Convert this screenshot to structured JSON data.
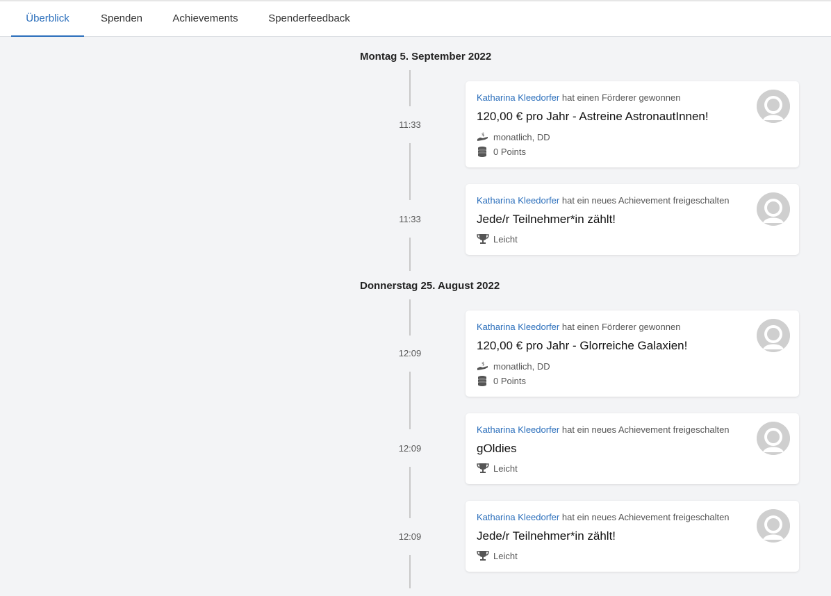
{
  "tabs": [
    {
      "label": "Überblick",
      "active": true
    },
    {
      "label": "Spenden",
      "active": false
    },
    {
      "label": "Achievements",
      "active": false
    },
    {
      "label": "Spenderfeedback",
      "active": false
    }
  ],
  "groups": [
    {
      "date": "Montag 5. September 2022",
      "entries": [
        {
          "time": "11:33",
          "user": "Katharina Kleedorfer",
          "action": "hat einen Förderer gewonnen",
          "title": "120,00 € pro Jahr - Astreine AstronautInnen!",
          "frequency": "monatlich, DD",
          "points": "0 Points"
        },
        {
          "time": "11:33",
          "user": "Katharina Kleedorfer",
          "action": "hat ein neues Achievement freigeschalten",
          "title": "Jede/r Teilnehmer*in zählt!",
          "difficulty": "Leicht"
        }
      ]
    },
    {
      "date": "Donnerstag 25. August 2022",
      "entries": [
        {
          "time": "12:09",
          "user": "Katharina Kleedorfer",
          "action": "hat einen Förderer gewonnen",
          "title": "120,00 € pro Jahr - Glorreiche Galaxien!",
          "frequency": "monatlich, DD",
          "points": "0 Points"
        },
        {
          "time": "12:09",
          "user": "Katharina Kleedorfer",
          "action": "hat ein neues Achievement freigeschalten",
          "title": "gOldies",
          "difficulty": "Leicht"
        },
        {
          "time": "12:09",
          "user": "Katharina Kleedorfer",
          "action": "hat ein neues Achievement freigeschalten",
          "title": "Jede/r Teilnehmer*in zählt!",
          "difficulty": "Leicht"
        }
      ]
    }
  ],
  "icons": {
    "donation": "hand-coin-icon",
    "points": "coin-stack-icon",
    "achievement": "trophy-icon",
    "avatar": "user-placeholder-icon"
  },
  "colors": {
    "accent": "#2a6ebb",
    "background": "#f3f4f6",
    "card": "#ffffff",
    "timeline": "#c8c8c8"
  }
}
